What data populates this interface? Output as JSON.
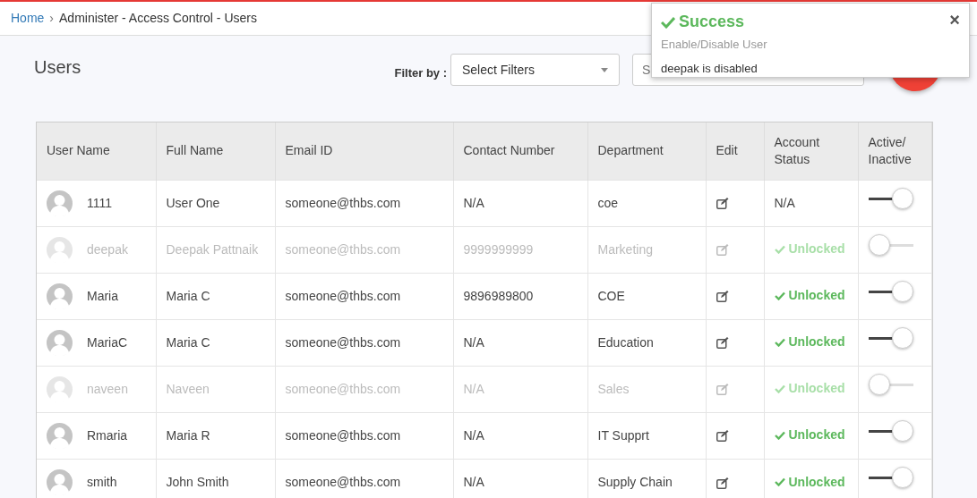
{
  "breadcrumb": {
    "home": "Home",
    "separator": "›",
    "current": "Administer - Access Control - Users"
  },
  "page": {
    "title": "Users",
    "filter_label": "Filter by :",
    "filter_select": "Select Filters",
    "search": {
      "placeholder": "S"
    }
  },
  "toast": {
    "title": "Success",
    "subtitle": "Enable/Disable User",
    "message": "deepak is disabled",
    "close": "×"
  },
  "table": {
    "columns": [
      "User Name",
      "Full Name",
      "Email ID",
      "Contact Number",
      "Department",
      "Edit",
      "Account Status",
      "Active/ Inactive"
    ],
    "rows": [
      {
        "user": "1111",
        "full_name": "User One",
        "email": "someone@thbs.com",
        "contact": "N/A",
        "department": "coe",
        "status": {
          "kind": "plain",
          "text": "N/A"
        },
        "active": true
      },
      {
        "user": "deepak",
        "full_name": "Deepak Pattnaik",
        "email": "someone@thbs.com",
        "contact": "9999999999",
        "department": "Marketing",
        "status": {
          "kind": "unlocked",
          "text": "Unlocked"
        },
        "active": false
      },
      {
        "user": "Maria",
        "full_name": "Maria C",
        "email": "someone@thbs.com",
        "contact": "9896989800",
        "department": "COE",
        "status": {
          "kind": "unlocked",
          "text": "Unlocked"
        },
        "active": true
      },
      {
        "user": "MariaC",
        "full_name": "Maria C",
        "email": "someone@thbs.com",
        "contact": "N/A",
        "department": "Education",
        "status": {
          "kind": "unlocked",
          "text": "Unlocked"
        },
        "active": true
      },
      {
        "user": "naveen",
        "full_name": "Naveen",
        "email": "someone@thbs.com",
        "contact": "N/A",
        "department": "Sales",
        "status": {
          "kind": "unlocked",
          "text": "Unlocked"
        },
        "active": false
      },
      {
        "user": "Rmaria",
        "full_name": "Maria R",
        "email": "someone@thbs.com",
        "contact": "N/A",
        "department": "IT Supprt",
        "status": {
          "kind": "unlocked",
          "text": "Unlocked"
        },
        "active": true
      },
      {
        "user": "smith",
        "full_name": "John Smith",
        "email": "someone@thbs.com",
        "contact": "N/A",
        "department": "Supply Chain",
        "status": {
          "kind": "unlocked",
          "text": "Unlocked"
        },
        "active": true
      }
    ]
  }
}
